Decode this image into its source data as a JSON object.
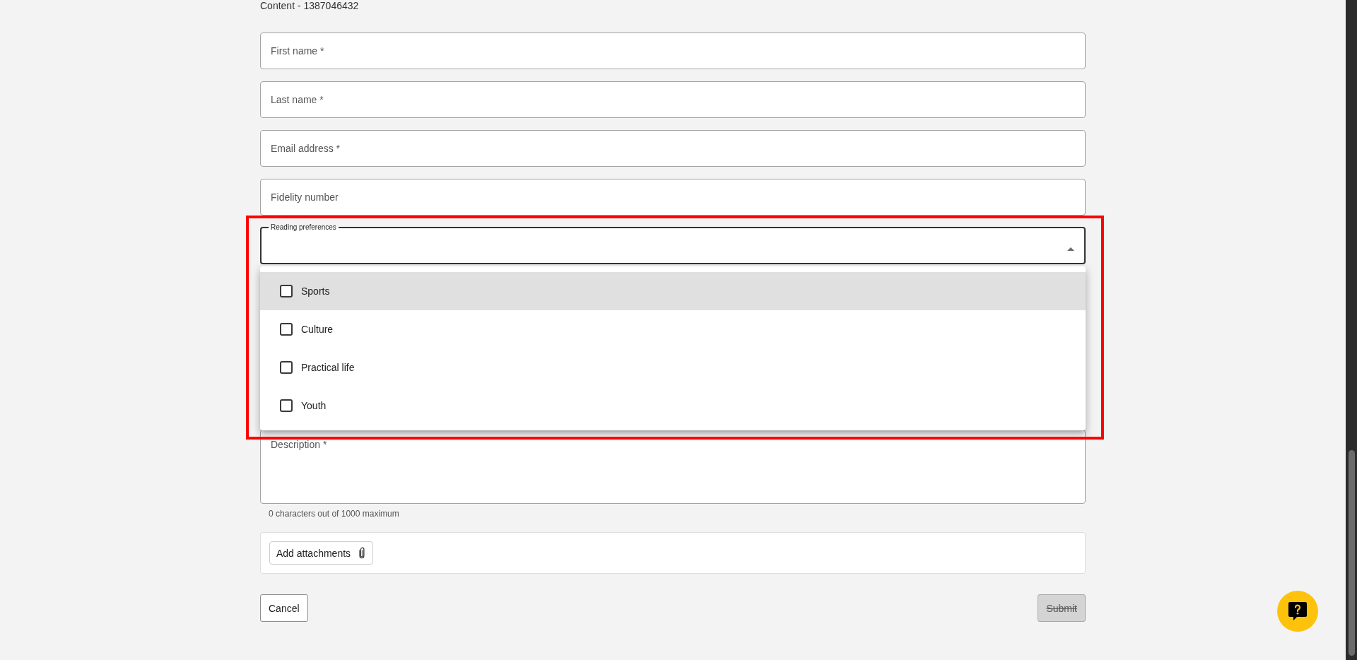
{
  "page": {
    "heading": "Content - 1387046432"
  },
  "form": {
    "fields": [
      {
        "placeholder": "First name *"
      },
      {
        "placeholder": "Last name *"
      },
      {
        "placeholder": "Email address *"
      },
      {
        "placeholder": "Fidelity number"
      }
    ],
    "reading_preferences": {
      "label": "Reading preferences",
      "expanded": true,
      "options": [
        {
          "label": "Sports",
          "checked": false,
          "highlighted": true
        },
        {
          "label": "Culture",
          "checked": false,
          "highlighted": false
        },
        {
          "label": "Practical life",
          "checked": false,
          "highlighted": false
        },
        {
          "label": "Youth",
          "checked": false,
          "highlighted": false
        }
      ]
    },
    "description": {
      "placeholder": "Description *",
      "counter": "0 characters out of 1000 maximum"
    },
    "attachments": {
      "button": "Add attachments"
    },
    "actions": [
      {
        "label": "Cancel",
        "kind": "secondary",
        "disabled": false
      },
      {
        "label": "Submit",
        "kind": "primary",
        "disabled": true
      }
    ]
  }
}
